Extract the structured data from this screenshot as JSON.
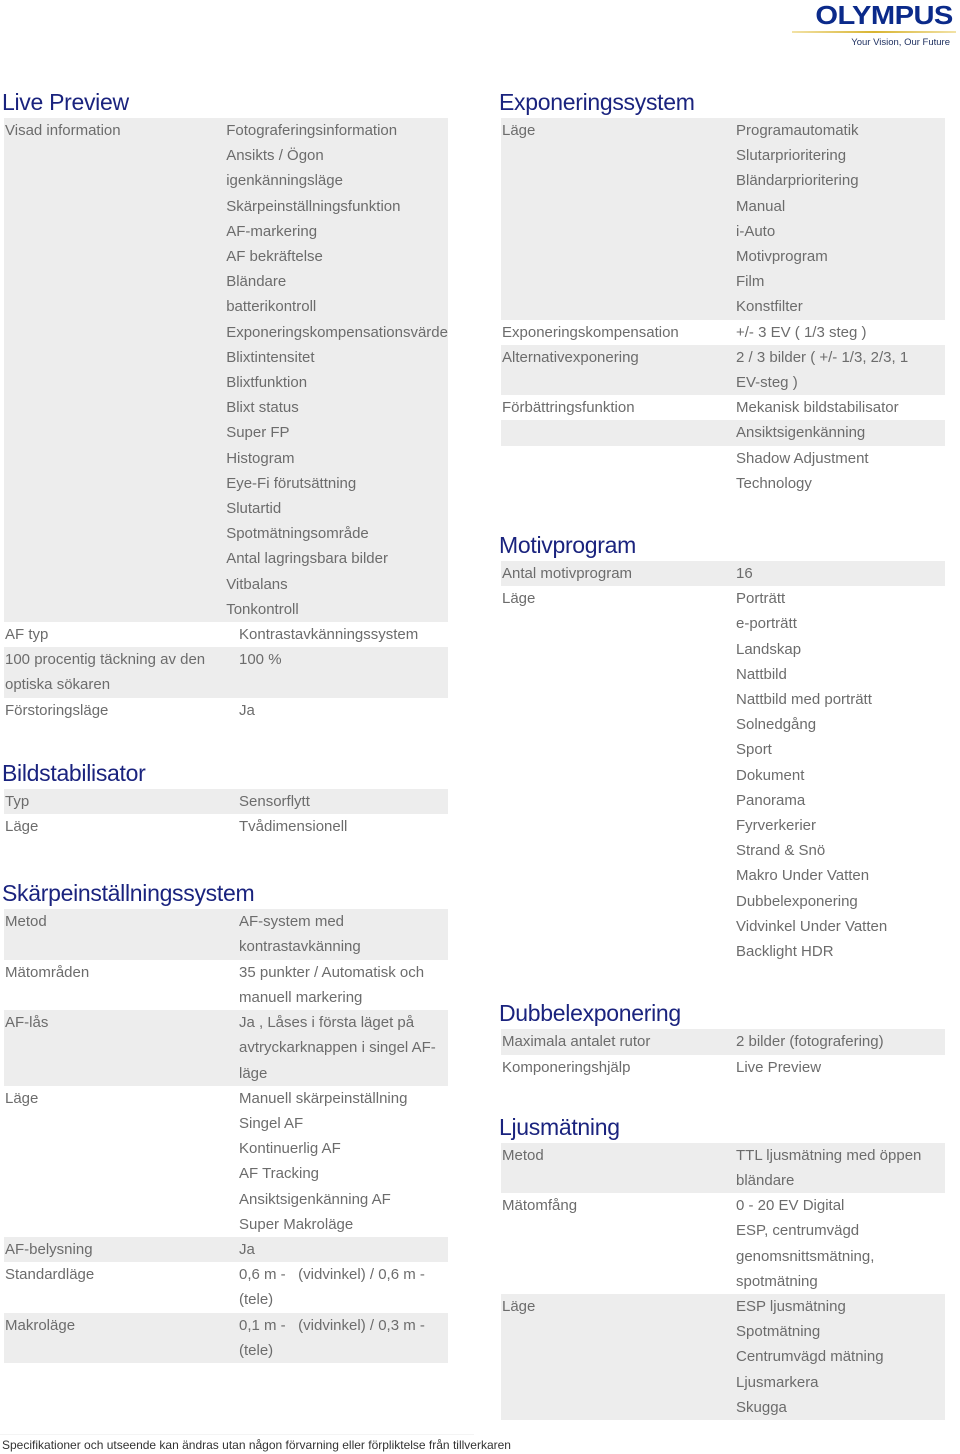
{
  "brand": {
    "name": "OLYMPUS",
    "tagline": "Your Vision, Our Future",
    "colors": {
      "logo": "#0b2a8a",
      "rule": "#d8b431",
      "heading": "#1a237e",
      "shade": "#ededed",
      "text": "#6c6c6c"
    }
  },
  "left_column": [
    {
      "title": "Live Preview",
      "rows": [
        {
          "label": "Visad information",
          "shaded": true,
          "values": [
            "Fotograferingsinformation",
            "Ansikts / Ögon",
            "igenkänningsläge",
            "Skärpeinställningsfunktion",
            "AF-markering",
            "AF bekräftelse",
            "Bländare",
            "batterikontroll",
            "Exponeringskompensationsvärde",
            "Blixtintensitet",
            "Blixtfunktion",
            "Blixt status",
            "Super FP",
            "Histogram",
            "Eye-Fi förutsättning",
            "Slutartid",
            "Spotmätningsområde",
            "Antal lagringsbara bilder",
            "Vitbalans",
            "Tonkontroll"
          ]
        },
        {
          "label": "AF typ",
          "shaded": false,
          "values": [
            "Kontrastavkänningssystem"
          ]
        },
        {
          "label": "100 procentig täckning av den\noptiska sökaren",
          "label_lines": [
            "100 procentig täckning av den",
            "optiska sökaren"
          ],
          "shaded": true,
          "values": [
            "100 %"
          ]
        },
        {
          "label": "Förstoringsläge",
          "shaded": false,
          "values": [
            "Ja"
          ]
        }
      ]
    },
    {
      "title": "Bildstabilisator",
      "rows": [
        {
          "label": "Typ",
          "shaded": true,
          "values": [
            "Sensorflytt"
          ]
        },
        {
          "label": "Läge",
          "shaded": false,
          "values": [
            "Tvådimensionell"
          ]
        }
      ]
    },
    {
      "title": "Skärpeinställningssystem",
      "rows": [
        {
          "label": "Metod",
          "shaded": true,
          "values": [
            "AF-system med",
            "kontrastavkänning"
          ]
        },
        {
          "label": "Mätområden",
          "shaded": false,
          "values": [
            "35 punkter / Automatisk och",
            "manuell markering"
          ]
        },
        {
          "label": "AF-lås",
          "shaded": true,
          "values": [
            "Ja , Låses i första läget på",
            "avtryckarknappen i singel AF-",
            "läge"
          ]
        },
        {
          "label": "Läge",
          "shaded": false,
          "values": [
            "Manuell skärpeinställning",
            "Singel AF",
            "Kontinuerlig AF",
            "AF Tracking",
            "Ansiktsigenkänning AF",
            "Super Makroläge"
          ]
        },
        {
          "label": "AF-belysning",
          "shaded": true,
          "values": [
            "Ja"
          ]
        },
        {
          "label": "Standardläge",
          "shaded": false,
          "values": [
            "0,6 m -   (vidvinkel) / 0,6 m -",
            "(tele)"
          ]
        },
        {
          "label": "Makroläge",
          "shaded": true,
          "values": [
            "0,1 m -   (vidvinkel) / 0,3 m -",
            "(tele)"
          ]
        }
      ]
    }
  ],
  "right_column": [
    {
      "title": "Exponeringssystem",
      "rows": [
        {
          "label": "Läge",
          "shaded": true,
          "values": [
            "Programautomatik",
            "Slutarprioritering",
            "Bländarprioritering",
            "Manual",
            "i-Auto",
            "Motivprogram",
            "Film",
            "Konstfilter"
          ]
        },
        {
          "label": "Exponeringskompensation",
          "shaded": false,
          "values": [
            "+/- 3 EV ( 1/3 steg )"
          ]
        },
        {
          "label": "Alternativexponering",
          "shaded": true,
          "values": [
            "2 / 3 bilder ( +/- 1/3, 2/3, 1",
            "EV-steg )"
          ]
        },
        {
          "label": "Förbättringsfunktion",
          "shaded": false,
          "values": [
            "Mekanisk bildstabilisator"
          ]
        },
        {
          "label": "",
          "shaded": true,
          "values": [
            "Ansiktsigenkänning"
          ]
        },
        {
          "label": "",
          "shaded": false,
          "values": [
            "Shadow Adjustment",
            "Technology"
          ]
        }
      ]
    },
    {
      "title": "Motivprogram",
      "rows": [
        {
          "label": "Antal motivprogram",
          "shaded": true,
          "values": [
            "16"
          ]
        },
        {
          "label": "Läge",
          "shaded": false,
          "values": [
            "Porträtt",
            "e-porträtt",
            "Landskap",
            "Nattbild",
            "Nattbild med porträtt",
            "Solnedgång",
            "Sport",
            "Dokument",
            "Panorama",
            "Fyrverkerier",
            "Strand & Snö",
            "Makro Under Vatten",
            "Dubbelexponering",
            "Vidvinkel Under Vatten",
            "Backlight HDR"
          ]
        }
      ]
    },
    {
      "title": "Dubbelexponering",
      "rows": [
        {
          "label": "Maximala antalet rutor",
          "shaded": true,
          "values": [
            "2 bilder (fotografering)"
          ]
        },
        {
          "label": "Komponeringshjälp",
          "shaded": false,
          "values": [
            "Live Preview"
          ]
        }
      ]
    },
    {
      "title": "Ljusmätning",
      "rows": [
        {
          "label": "Metod",
          "shaded": true,
          "values": [
            "TTL ljusmätning med öppen",
            "bländare"
          ]
        },
        {
          "label": "Mätomfång",
          "shaded": false,
          "values": [
            "0 - 20 EV Digital",
            "ESP, centrumvägd",
            "genomsnittsmätning,",
            "spotmätning"
          ]
        },
        {
          "label": "Läge",
          "shaded": true,
          "values": [
            "ESP ljusmätning",
            "Spotmätning",
            "Centrumvägd mätning",
            "Ljusmarkera",
            "Skugga"
          ]
        }
      ]
    }
  ],
  "footer": {
    "disclaimer": "Specifikationer och utseende kan ändras utan någon förvarning eller förpliktelse från tillverkaren"
  }
}
